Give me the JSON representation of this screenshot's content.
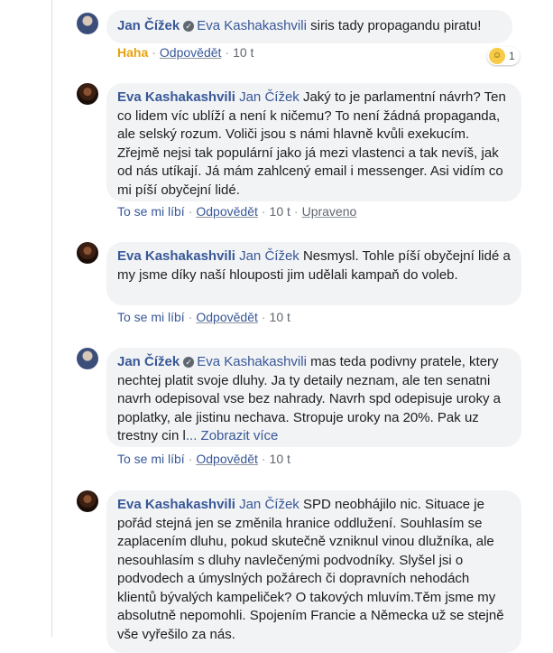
{
  "comments": [
    {
      "author": "Jan Čížek",
      "verified": true,
      "mention": "Eva Kashakashvili",
      "text": "siris tady propagandu piratu!",
      "reaction_label": "Haha",
      "reply_label": "Odpovědět",
      "time": "10 t",
      "reaction_icon": "haha-icon",
      "reaction_count": "1"
    },
    {
      "author": "Eva Kashakashvili",
      "mention": "Jan Čížek",
      "text": "Jaký to je parlamentní návrh? Ten co lidem víc ublíží a není k ničemu? To není žádná propaganda, ale selský rozum. Voliči jsou s námi hlavně kvůli exekucím. Zřejmě nejsi tak populární jako já mezi vlastenci a tak nevíš, jak od nás utíkají. Já mám zahlcený email i messenger. Asi vidím co mi píší obyčejní lidé.",
      "like_label": "To se mi líbí",
      "reply_label": "Odpovědět",
      "time": "10 t",
      "edited_label": "Upraveno"
    },
    {
      "author": "Eva Kashakashvili",
      "mention": "Jan Čížek",
      "text": "Nesmysl. Tohle píší obyčejní lidé a my jsme díky naší hlouposti jim udělali kampaň do voleb.",
      "like_label": "To se mi líbí",
      "reply_label": "Odpovědět",
      "time": "10 t"
    },
    {
      "author": "Jan Čížek",
      "verified": true,
      "mention": "Eva Kashakashvili",
      "text": "mas teda podivny pratele, ktery nechtej platit svoje dluhy. Ja ty detaily neznam, ale ten senatni navrh odepisoval vse bez nahrady. Navrh spd odepisuje uroky a poplatky, ale jistinu nechava. Stropuje uroky na 20%. Pak uz trestny cin l",
      "see_more_prefix": "... ",
      "see_more_label": "Zobrazit více",
      "like_label": "To se mi líbí",
      "reply_label": "Odpovědět",
      "time": "10 t"
    },
    {
      "author": "Eva Kashakashvili",
      "mention": "Jan Čížek",
      "text": "SPD neobhájilo nic. Situace je pořád stejná jen se změnila hranice oddlužení. Souhlasím se zaplacením dluhu, pokud skutečně vzniknul vinou dlužníka, ale nesouhlasím s dluhy navlečenými podvodníky. Slyšel jsi o podvodech a úmyslných požárech či dopravních nehodách klientů bývalých kampeliček? O takových mluvím.Těm jsme my absolutně nepomohli. Spojením Francie a Německa už se stejně vše vyřešilo za nás."
    }
  ]
}
